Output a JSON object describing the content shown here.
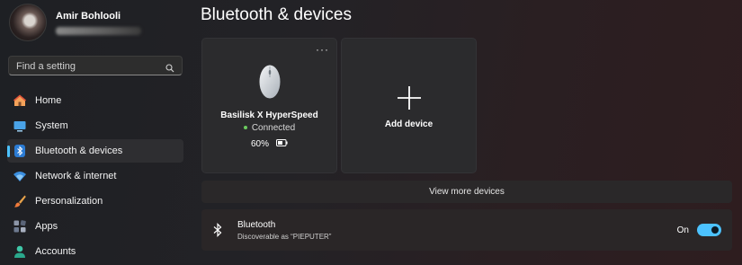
{
  "profile": {
    "name": "Amir Bohlooli"
  },
  "search": {
    "placeholder": "Find a setting"
  },
  "sidebar": {
    "items": [
      {
        "label": "Home",
        "icon": "home-icon"
      },
      {
        "label": "System",
        "icon": "system-icon"
      },
      {
        "label": "Bluetooth & devices",
        "icon": "bluetooth-icon",
        "active": true
      },
      {
        "label": "Network & internet",
        "icon": "wifi-icon"
      },
      {
        "label": "Personalization",
        "icon": "brush-icon"
      },
      {
        "label": "Apps",
        "icon": "apps-icon"
      },
      {
        "label": "Accounts",
        "icon": "account-icon"
      }
    ]
  },
  "main": {
    "title": "Bluetooth & devices",
    "device_card": {
      "name": "Basilisk X HyperSpeed",
      "status": "Connected",
      "battery": "60%",
      "more": "···"
    },
    "add_card": {
      "label": "Add device"
    },
    "view_more": "View more devices",
    "bluetooth": {
      "title": "Bluetooth",
      "subtitle": "Discoverable as “PIEPUTER”",
      "state": "On",
      "enabled": true
    }
  },
  "colors": {
    "accent": "#4cc2ff",
    "connected": "#6ccb5f"
  }
}
